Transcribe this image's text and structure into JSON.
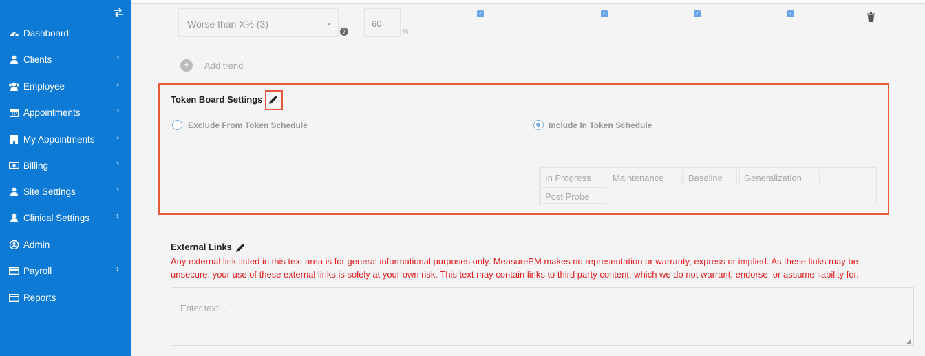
{
  "sidebar": {
    "toggle_icon": "swap-icon",
    "items": [
      {
        "label": "Dashboard",
        "icon": "tachometer-icon",
        "has_chevron": false
      },
      {
        "label": "Clients",
        "icon": "user-icon",
        "has_chevron": true
      },
      {
        "label": "Employee",
        "icon": "users-icon",
        "has_chevron": true
      },
      {
        "label": "Appointments",
        "icon": "calendar-icon",
        "has_chevron": true
      },
      {
        "label": "My Appointments",
        "icon": "building-icon",
        "has_chevron": true
      },
      {
        "label": "Billing",
        "icon": "money-icon",
        "has_chevron": true
      },
      {
        "label": "Site Settings",
        "icon": "user-icon",
        "has_chevron": true
      },
      {
        "label": "Clinical Settings",
        "icon": "user-icon",
        "has_chevron": true
      },
      {
        "label": "Admin",
        "icon": "user-circle-icon",
        "has_chevron": false
      },
      {
        "label": "Payroll",
        "icon": "credit-card-icon",
        "has_chevron": true
      },
      {
        "label": "Reports",
        "icon": "credit-card-icon",
        "has_chevron": false
      }
    ]
  },
  "trend_row": {
    "select_value": "Worse than X% (3)",
    "percent_value": "60",
    "percent_unit": "%",
    "checkbox_count": 4,
    "add_label": "Add trend"
  },
  "token_board": {
    "title": "Token Board Settings",
    "exclude_label": "Exclude From Token Schedule",
    "include_label": "Include In Token Schedule",
    "selected": "include",
    "phases": [
      "In Progress",
      "Maintenance",
      "Baseline",
      "Generalization",
      "Post Probe"
    ]
  },
  "external_links": {
    "title": "External Links",
    "disclaimer_line1": "Any external link listed in this text area is for general informational purposes only. MeasurePM makes no representation or warranty, express or implied. As these links may be",
    "disclaimer_line2": "unsecure, your use of these external links is solely at your own risk. This text may contain links to third party content, which we do not warrant, endorse, or assume liability for.",
    "placeholder": "Enter text..."
  },
  "colors": {
    "sidebar_bg": "#0d7ad6",
    "highlight": "#e8583c",
    "disclaimer": "#e02020",
    "accent": "#7aa9df"
  }
}
